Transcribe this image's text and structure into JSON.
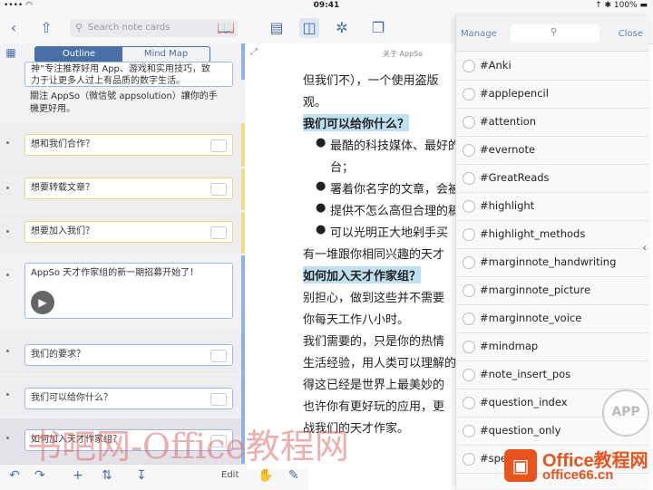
{
  "status": {
    "time": "09:41",
    "carrier": "•••• ◠",
    "battery": "↑ ✱ 100% ▬"
  },
  "toolbar": {
    "search_placeholder": "Search note cards"
  },
  "outline": {
    "tabs": [
      "Outline",
      "Mind Map"
    ],
    "top_card_lines": [
      "神”专注推荐好用 App、游戏和实用技巧，致",
      "力于让更多人过上有品质的数字生活。"
    ],
    "top_text_lines": [
      "關注 AppSo（微信號 appsolution）讓你的手",
      "機更好用。"
    ],
    "cards": [
      "想和我们合作？",
      "想要转载文章？",
      "想要加入我们？",
      "AppSo 天才作家组的新一期招募开始了！",
      "我们的要求？",
      "我们可以给你什么？",
      "如何加入天才作家组？"
    ],
    "edit_label": "Edit"
  },
  "document": {
    "crumb": "关于 AppSo",
    "lines": [
      "但我们不），一个使用盗版",
      "观。",
      "我们可以给你什么？",
      "最酷的科技媒体、最好的",
      "台；",
      "署着你名字的文章，会被",
      "提供不怎么高但合理的稿",
      "可以光明正大地剁手买",
      "有一堆跟你相同兴趣的天才",
      "如何加入天才作家组？",
      "别担心，做到这些并不需要",
      "你每天工作八小时。",
      "我们需要的，只是你的热情",
      "生活经验，用人类可以理解的",
      "得这已经是世界上最美妙的",
      "也许你有更好玩的应用，更",
      "战我们的天才作家。"
    ]
  },
  "tags": {
    "manage": "Manage",
    "close": "Close",
    "items": [
      "#Anki",
      "#applepencil",
      "#attention",
      "#evernote",
      "#GreatReads",
      "#highlight",
      "#highlight_methods",
      "#marginnote_handwriting",
      "#marginnote_picture",
      "#marginnote_voice",
      "#mindmap",
      "#note_insert_pos",
      "#question_index",
      "#question_only",
      "#spe"
    ]
  },
  "watermark": "书吧网-Office教程网",
  "logo": {
    "line1": "Office教程网",
    "line2": "office66.cn"
  },
  "appso_badge": "APP"
}
